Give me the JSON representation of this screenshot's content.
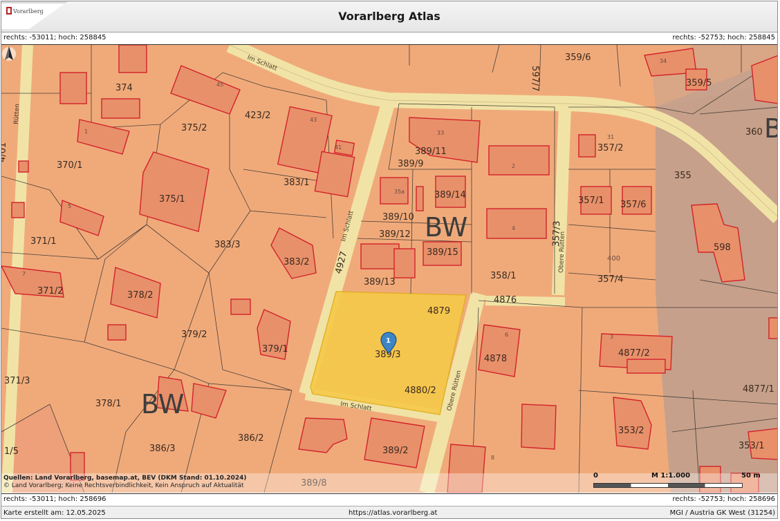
{
  "header": {
    "title": "Vorarlberg Atlas",
    "logo_text": "Vorarlberg"
  },
  "coords": {
    "top_left": "rechts: -53011; hoch: 258845",
    "top_right": "rechts: -52753; hoch: 258845",
    "bottom_left": "rechts: -53011; hoch: 258696",
    "bottom_right": "rechts: -52753; hoch: 258696"
  },
  "map": {
    "zones": [
      "BW",
      "BW",
      "B"
    ],
    "streets": [
      "Im Schlatt",
      "Im Schlatt",
      "Im Schlatt",
      "Obere Rütten",
      "Obere Rütten",
      "Rütten"
    ],
    "parcels": [
      "359/6",
      "359/5",
      "374",
      "375/2",
      "423/2",
      "360",
      "370/1",
      "389/11",
      "389/9",
      "357/2",
      "383/1",
      "375/1",
      "389/14",
      "355",
      "389/10",
      "357/1",
      "357/6",
      "371/1",
      "383/3",
      "389/12",
      "383/2",
      "389/15",
      "598",
      "357/4",
      "371/2",
      "378/2",
      "389/13",
      "358/1",
      "4879",
      "4876",
      "379/2",
      "379/1",
      "389/3",
      "4878",
      "4877/2",
      "371/3",
      "4880/2",
      "4877/1",
      "378/1",
      "353/2",
      "386/3",
      "386/2",
      "389/2",
      "353/1",
      "389/8",
      "4927",
      "357/3",
      "597/7",
      "4/01",
      "1/5"
    ],
    "house_numbers": [
      "45",
      "43",
      "41",
      "33",
      "35a",
      "2",
      "4",
      "31",
      "34",
      "1",
      "5",
      "7",
      "3",
      "6",
      "8",
      "400"
    ],
    "marker": "1",
    "sources_line1": "Quellen: Land Vorarlberg, basemap.at, BEV (DKM Stand: 01.10.2024)",
    "sources_line2": "© Land Vorarlberg; Keine Rechtsverbindlichkeit, Kein Anspruch auf Aktualität",
    "scale": {
      "start": "0",
      "ratio": "M 1:1.000",
      "end": "50 m"
    }
  },
  "footer": {
    "created": "Karte erstellt am: 12.05.2025",
    "url": "https://atlas.vorarlberg.at",
    "crs": "MGI / Austria GK West (31254)"
  }
}
